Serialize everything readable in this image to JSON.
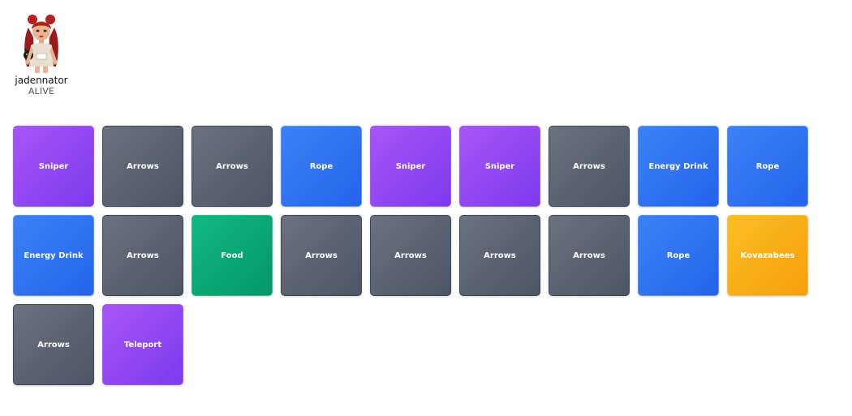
{
  "player": {
    "name": "jadennator",
    "status": "ALIVE"
  },
  "colors": {
    "gray": "#6b7280",
    "purple": "#a855f7",
    "blue": "#3b82f6",
    "green": "#10b981",
    "amber": "#fbbf24"
  },
  "items": [
    {
      "label": "Sniper",
      "color": "purple"
    },
    {
      "label": "Arrows",
      "color": "gray"
    },
    {
      "label": "Arrows",
      "color": "gray"
    },
    {
      "label": "Rope",
      "color": "blue"
    },
    {
      "label": "Sniper",
      "color": "purple"
    },
    {
      "label": "Sniper",
      "color": "purple"
    },
    {
      "label": "Arrows",
      "color": "gray"
    },
    {
      "label": "Energy Drink",
      "color": "blue"
    },
    {
      "label": "Rope",
      "color": "blue"
    },
    {
      "label": "Energy Drink",
      "color": "blue"
    },
    {
      "label": "Arrows",
      "color": "gray"
    },
    {
      "label": "Food",
      "color": "green"
    },
    {
      "label": "Arrows",
      "color": "gray"
    },
    {
      "label": "Arrows",
      "color": "gray"
    },
    {
      "label": "Arrows",
      "color": "gray"
    },
    {
      "label": "Arrows",
      "color": "gray"
    },
    {
      "label": "Rope",
      "color": "blue"
    },
    {
      "label": "Kovazabees",
      "color": "amber"
    },
    {
      "label": "Arrows",
      "color": "gray"
    },
    {
      "label": "Teleport",
      "color": "purple"
    }
  ]
}
